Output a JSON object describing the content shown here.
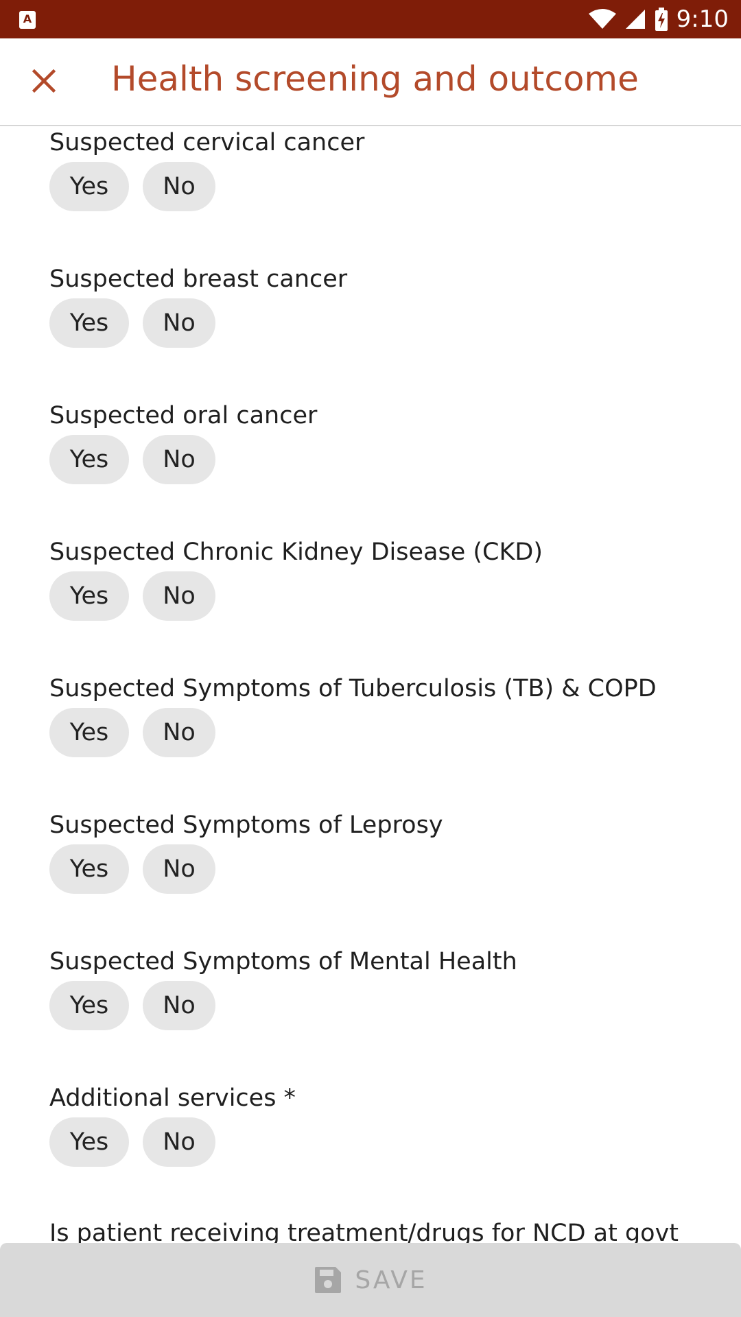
{
  "status_bar": {
    "app_icon_letter": "A",
    "time": "9:10",
    "icons": [
      "wifi-icon",
      "cell-signal-icon",
      "battery-charging-icon"
    ]
  },
  "header": {
    "close_icon": "close-icon",
    "title": "Health screening and outcome",
    "title_color": "#b34a2a",
    "bar_color": "#7f1d08"
  },
  "questions": [
    {
      "label": "Suspected cervical cancer",
      "yes": "Yes",
      "no": "No"
    },
    {
      "label": "Suspected breast cancer",
      "yes": "Yes",
      "no": "No"
    },
    {
      "label": "Suspected oral cancer",
      "yes": "Yes",
      "no": "No"
    },
    {
      "label": "Suspected Chronic Kidney Disease (CKD)",
      "yes": "Yes",
      "no": "No"
    },
    {
      "label": "Suspected Symptoms of Tuberculosis (TB) & COPD",
      "yes": "Yes",
      "no": "No"
    },
    {
      "label": "Suspected Symptoms of Leprosy",
      "yes": "Yes",
      "no": "No"
    },
    {
      "label": "Suspected Symptoms of Mental Health",
      "yes": "Yes",
      "no": "No"
    },
    {
      "label": "Additional services *",
      "yes": "Yes",
      "no": "No"
    }
  ],
  "partial_question": "Is patient receiving treatment/drugs for NCD at govt",
  "footer": {
    "save_label": "SAVE",
    "save_icon": "save-icon"
  }
}
